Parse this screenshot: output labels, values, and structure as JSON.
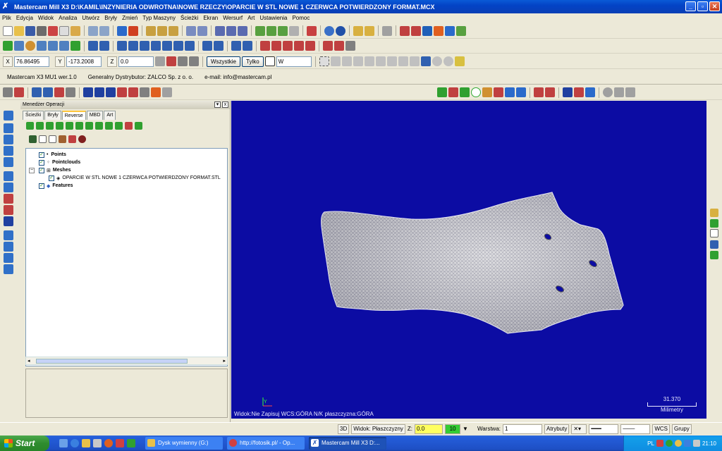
{
  "window": {
    "title": "Mastercam Mill X3  D:\\KAMIL\\INZYNIERIA ODWROTNA\\NOWE RZECZY\\OPARCIE W STL NOWE 1 CZERWCA POTWIERDZONY FORMAT.MCX",
    "minimize": "_",
    "maximize": "▫",
    "close": "✕"
  },
  "menu": [
    "Plik",
    "Edycja",
    "Widok",
    "Analiza",
    "Utwórz",
    "Bryły",
    "Zmień",
    "Typ Maszyny",
    "Ścieżki",
    "Ekran",
    "Wersurf",
    "Art",
    "Ustawienia",
    "Pomoc"
  ],
  "coords": {
    "x_label": "X",
    "x_value": "76.86495",
    "y_label": "Y",
    "y_value": "-173.2008",
    "z_label": "Z",
    "z_value": "0.0",
    "all_button": "Wszystkie",
    "only_button": "Tylko",
    "level_value": "W"
  },
  "info": {
    "version": "Mastercam X3 MU1 wer.1.0",
    "distributor": "Generalny Dystrybutor: ZALCO Sp. z o. o.",
    "email": "e-mail:  info@mastercam.pl"
  },
  "panel": {
    "title": "Menedżer Operacji",
    "tabs": [
      "Ścieżki",
      "Bryły",
      "Reverse",
      "MBD",
      "Art"
    ],
    "active_tab": "Reverse",
    "tree": [
      {
        "label": "Points",
        "checked": true
      },
      {
        "label": "Pointclouds",
        "checked": true
      },
      {
        "label": "Meshes",
        "checked": true
      },
      {
        "label": "OPARCIE W STL NOWE 1 CZERWCA POTWIERDZONY FORMAT.STL",
        "checked": true
      },
      {
        "label": "Features",
        "checked": true
      }
    ]
  },
  "viewport": {
    "background": "#0c0ca3",
    "status_text": "Widok:Nie Zapisuj    WCS:GÓRA    N/K płaszczyzna:GÓRA",
    "axis_label": "Y",
    "scale_value": "31.370",
    "scale_unit": "Milimetry"
  },
  "statusbar": {
    "mode": "3D",
    "view": "Widok: Płaszczyzny",
    "z_label": "Z:",
    "z_value": "0.0",
    "color_value": "10",
    "layer_label": "Warstwa:",
    "layer_value": "1",
    "attributes": "Atrybuty",
    "wcs": "WCS",
    "groups": "Grupy"
  },
  "taskbar": {
    "start": "Start",
    "tasks": [
      {
        "label": "Dysk wymienny (G:)",
        "active": false
      },
      {
        "label": "http://fotosik.pl/ - Op...",
        "active": false
      },
      {
        "label": "Mastercam Mill X3 D:...",
        "active": true
      }
    ],
    "lang": "PL",
    "clock": "21:10"
  }
}
